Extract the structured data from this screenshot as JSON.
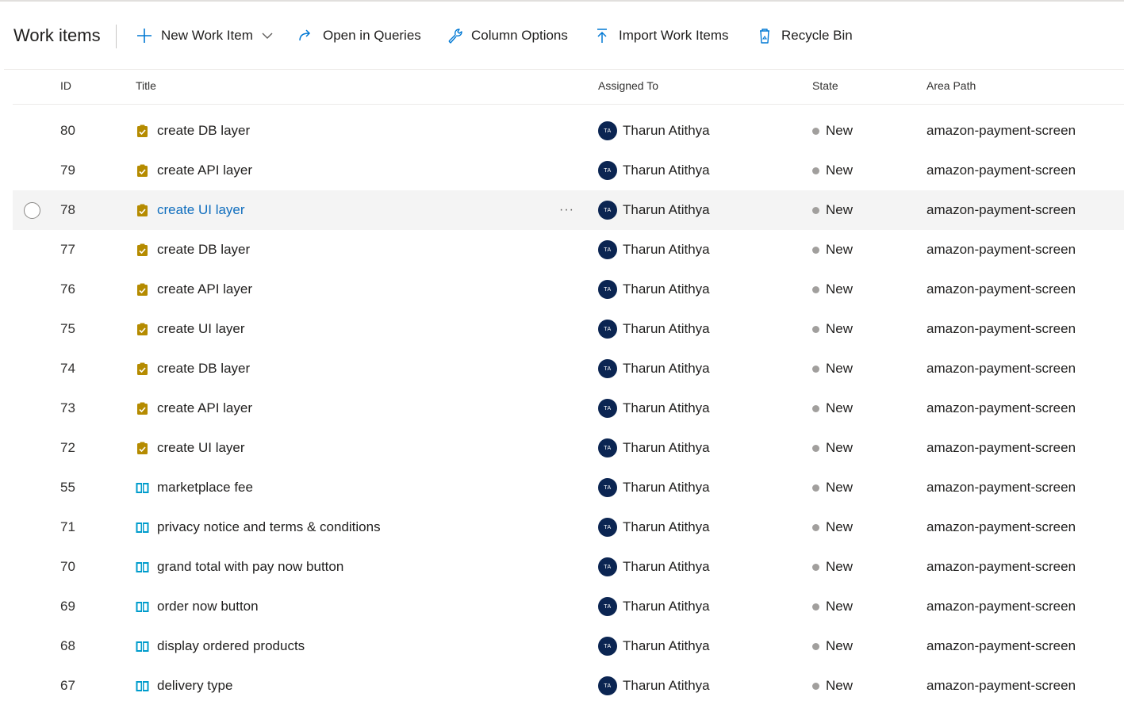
{
  "page": {
    "title": "Work items"
  },
  "toolbar": {
    "new_work_item": "New Work Item",
    "open_in_queries": "Open in Queries",
    "column_options": "Column Options",
    "import_work_items": "Import Work Items",
    "recycle_bin": "Recycle Bin"
  },
  "columns": {
    "id": "ID",
    "title": "Title",
    "assigned_to": "Assigned To",
    "state": "State",
    "area_path": "Area Path"
  },
  "colors": {
    "task_icon": "#b58b00",
    "story_icon": "#009ccc",
    "avatar_bg": "#0b2552",
    "state_new_dot": "#a19f9d",
    "link_hover": "#106ebe",
    "accent": "#0078d4"
  },
  "rows": [
    {
      "id": "80",
      "title": "create DB layer",
      "type": "task",
      "assigned": "Tharun Atithya",
      "initials": "TA",
      "state": "New",
      "area": "amazon-payment-screen",
      "hover": false
    },
    {
      "id": "79",
      "title": "create API layer",
      "type": "task",
      "assigned": "Tharun Atithya",
      "initials": "TA",
      "state": "New",
      "area": "amazon-payment-screen",
      "hover": false
    },
    {
      "id": "78",
      "title": "create UI layer",
      "type": "task",
      "assigned": "Tharun Atithya",
      "initials": "TA",
      "state": "New",
      "area": "amazon-payment-screen",
      "hover": true,
      "more": "···"
    },
    {
      "id": "77",
      "title": "create DB layer",
      "type": "task",
      "assigned": "Tharun Atithya",
      "initials": "TA",
      "state": "New",
      "area": "amazon-payment-screen",
      "hover": false
    },
    {
      "id": "76",
      "title": "create API layer",
      "type": "task",
      "assigned": "Tharun Atithya",
      "initials": "TA",
      "state": "New",
      "area": "amazon-payment-screen",
      "hover": false
    },
    {
      "id": "75",
      "title": "create UI layer",
      "type": "task",
      "assigned": "Tharun Atithya",
      "initials": "TA",
      "state": "New",
      "area": "amazon-payment-screen",
      "hover": false
    },
    {
      "id": "74",
      "title": "create DB layer",
      "type": "task",
      "assigned": "Tharun Atithya",
      "initials": "TA",
      "state": "New",
      "area": "amazon-payment-screen",
      "hover": false
    },
    {
      "id": "73",
      "title": "create API layer",
      "type": "task",
      "assigned": "Tharun Atithya",
      "initials": "TA",
      "state": "New",
      "area": "amazon-payment-screen",
      "hover": false
    },
    {
      "id": "72",
      "title": "create UI layer",
      "type": "task",
      "assigned": "Tharun Atithya",
      "initials": "TA",
      "state": "New",
      "area": "amazon-payment-screen",
      "hover": false
    },
    {
      "id": "55",
      "title": "marketplace fee",
      "type": "story",
      "assigned": "Tharun Atithya",
      "initials": "TA",
      "state": "New",
      "area": "amazon-payment-screen",
      "hover": false
    },
    {
      "id": "71",
      "title": "privacy notice and terms & conditions",
      "type": "story",
      "assigned": "Tharun Atithya",
      "initials": "TA",
      "state": "New",
      "area": "amazon-payment-screen",
      "hover": false
    },
    {
      "id": "70",
      "title": "grand total with pay now button",
      "type": "story",
      "assigned": "Tharun Atithya",
      "initials": "TA",
      "state": "New",
      "area": "amazon-payment-screen",
      "hover": false
    },
    {
      "id": "69",
      "title": "order now button",
      "type": "story",
      "assigned": "Tharun Atithya",
      "initials": "TA",
      "state": "New",
      "area": "amazon-payment-screen",
      "hover": false
    },
    {
      "id": "68",
      "title": "display ordered products",
      "type": "story",
      "assigned": "Tharun Atithya",
      "initials": "TA",
      "state": "New",
      "area": "amazon-payment-screen",
      "hover": false
    },
    {
      "id": "67",
      "title": "delivery type",
      "type": "story",
      "assigned": "Tharun Atithya",
      "initials": "TA",
      "state": "New",
      "area": "amazon-payment-screen",
      "hover": false
    }
  ]
}
